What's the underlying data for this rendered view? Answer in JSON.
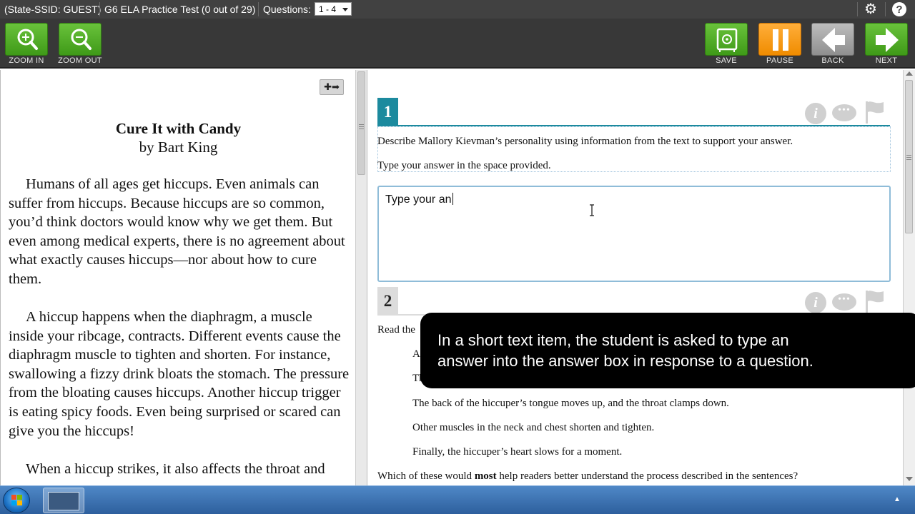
{
  "infobar": {
    "ssid": "(State-SSID: GUEST)",
    "test_title": "G6 ELA Practice Test (0 out of 29)",
    "questions_label": "Questions:",
    "questions_value": "1 - 4"
  },
  "icons": {
    "settings": "gear-icon",
    "help": "help-icon"
  },
  "toolbar": {
    "zoom_in": "ZOOM IN",
    "zoom_out": "ZOOM OUT",
    "save": "SAVE",
    "pause": "PAUSE",
    "back": "BACK",
    "next": "NEXT"
  },
  "passage": {
    "title": "Cure It with Candy",
    "author": "by Bart King",
    "paragraphs": [
      "Humans of all ages get hiccups. Even animals can suffer from hiccups. Because hiccups are so common, you’d think doctors would know why we get them. But even among medical experts, there is no agreement about what exactly causes hiccups—nor about how to cure them.",
      "A hiccup happens when the diaphragm, a muscle inside your ribcage, contracts. Different events cause the diaphragm muscle to tighten and shorten. For instance, swallowing a fizzy drink bloats the stomach. The pressure from the bloating causes hiccups. Another hiccup trigger is eating spicy foods. Even being surprised or scared can give you the hiccups!",
      "When a hiccup strikes, it also affects the throat and"
    ]
  },
  "question1": {
    "number": "1",
    "prompt": "Describe Mallory Kievman’s personality using information from the text to support your answer.",
    "instruction": "Type your answer in the space provided.",
    "answer_value": "Type your an"
  },
  "question2": {
    "number": "2",
    "lead": "Read the",
    "step_a": "A",
    "step_b": "Th",
    "steps": [
      "The back of the hiccuper’s tongue moves up, and the throat clamps down.",
      "Other muscles in the neck and chest shorten and tighten.",
      "Finally, the hiccuper’s heart slows for a moment."
    ],
    "question_start": "Which of these would ",
    "question_bold": "most",
    "question_end": " help readers better understand the process described in the sentences?"
  },
  "caption": {
    "line1": "In a short text item, the student is asked to type an",
    "line2": "answer into the answer box in response to a question."
  },
  "colors": {
    "q1_accent": "#1c8a9e",
    "q2_accent": "#d9d9d9",
    "green": "#4fa823",
    "orange": "#f59a12",
    "grey": "#a3a3a3"
  }
}
